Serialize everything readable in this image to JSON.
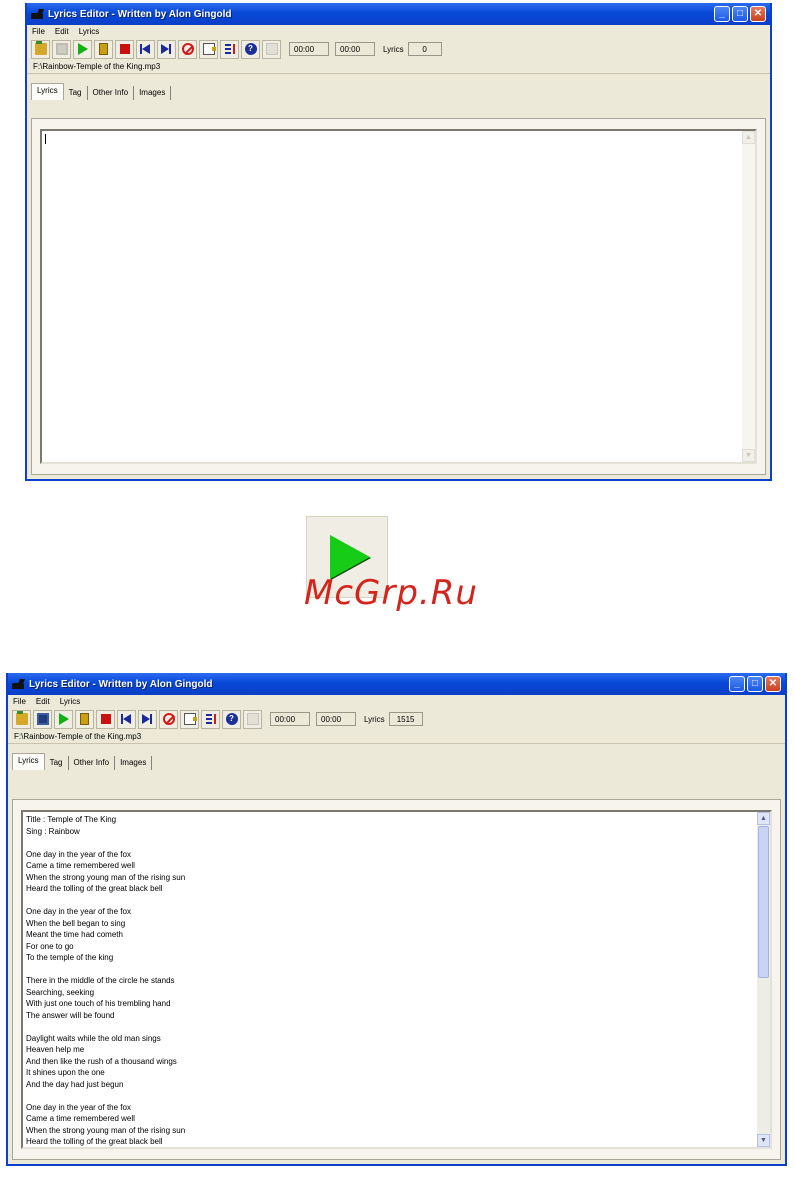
{
  "window_title": "Lyrics Editor - Written by Alon Gingold",
  "menu": [
    "File",
    "Edit",
    "Lyrics"
  ],
  "toolbar_icons": [
    "open-folder-icon",
    "save-icon",
    "play-icon",
    "pause-icon",
    "stop-icon",
    "previous-track-icon",
    "next-track-icon",
    "no-entry-icon",
    "mark-icon",
    "sort-icon",
    "help-icon",
    "document-icon"
  ],
  "readouts": {
    "time_elapsed": "00:00",
    "time_total": "00:00",
    "lyrics_label": "Lyrics"
  },
  "file_path": "F:\\Rainbow-Temple of the King.mp3",
  "tabs": [
    "Lyrics",
    "Tag",
    "Other Info",
    "Images"
  ],
  "window1": {
    "lyrics_count": "0"
  },
  "window2": {
    "lyrics_count": "1515",
    "lyrics_text": "Title : Temple of The King\nSing : Rainbow\n\nOne day in the year of the fox\nCame a time remembered well\nWhen the strong young man of the rising sun\nHeard the tolling of the great black bell\n\nOne day in the year of the fox\nWhen the bell began to sing\nMeant the time had cometh\nFor one to go\nTo the temple of the king\n\nThere in the middle of the circle he stands\nSearching, seeking\nWith just one touch of his trembling hand\nThe answer will be found\n\nDaylight waits while the old man sings\nHeaven help me\nAnd then like the rush of a thousand wings\nIt shines upon the one\nAnd the day had just begun\n\nOne day in the year of the fox\nCame a time remembered well\nWhen the strong young man of the rising sun\nHeard the tolling of the great black bell"
  },
  "watermark": "McGrp.Ru",
  "colors": {
    "play_green": "#16cc16",
    "title_blue": "#0848d8",
    "watermark_red": "#d4241c"
  }
}
